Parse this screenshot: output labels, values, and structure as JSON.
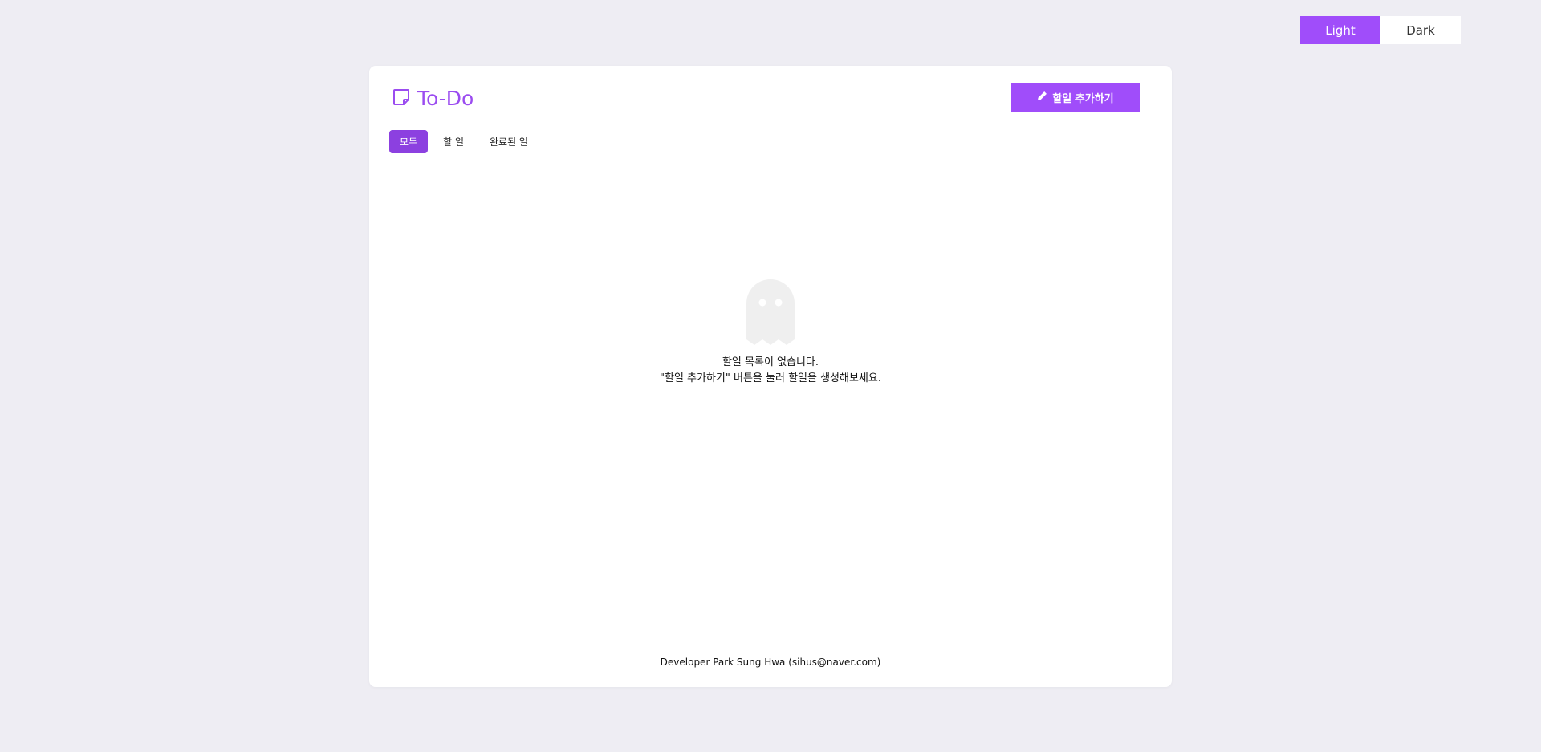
{
  "theme_toggle": {
    "light_label": "Light",
    "dark_label": "Dark",
    "selected": "Light"
  },
  "header": {
    "title": "To-Do",
    "icon": "sticky-note-icon",
    "add_button_label": "할일 추가하기",
    "add_button_icon": "pencil-icon"
  },
  "tabs": [
    {
      "label": "모두",
      "active": true
    },
    {
      "label": "할 일",
      "active": false
    },
    {
      "label": "완료된 일",
      "active": false
    }
  ],
  "empty_state": {
    "icon": "ghost-icon",
    "line1": "할일 목록이 없습니다.",
    "line2": "\"할일 추가하기\" 버튼을 눌러 할일을 생성해보세요."
  },
  "footer": {
    "text": "Developer Park Sung Hwa (sihus@naver.com)"
  },
  "colors": {
    "accent": "#a04dfa",
    "tab_active": "#8c40e0",
    "background": "#eeedf3",
    "card": "#ffffff",
    "ghost": "#efefef"
  }
}
